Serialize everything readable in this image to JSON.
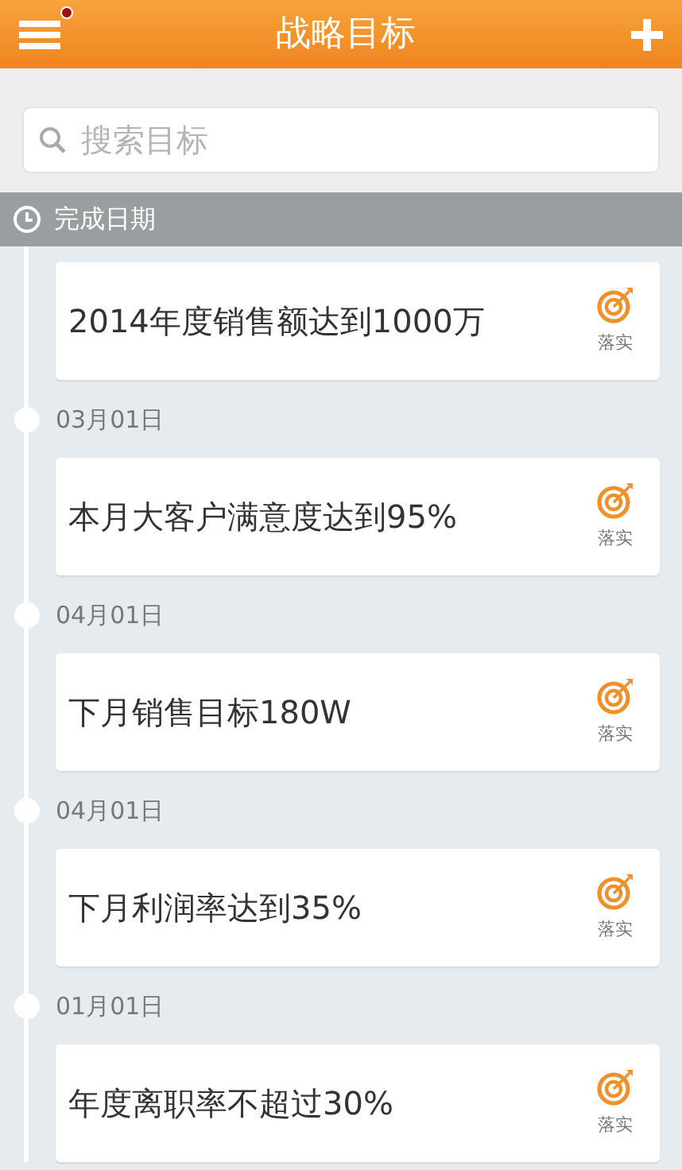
{
  "header": {
    "title": "战略目标",
    "menu_notification": true
  },
  "search": {
    "placeholder": "搜索目标"
  },
  "section": {
    "label": "完成日期"
  },
  "goals": [
    {
      "title": "2014年度销售额达到1000万",
      "action": "落实"
    },
    {
      "date": "03月01日",
      "title": "本月大客户满意度达到95%",
      "action": "落实"
    },
    {
      "date": "04月01日",
      "title": "下月销售目标180W",
      "action": "落实"
    },
    {
      "date": "04月01日",
      "title": "下月利润率达到35%",
      "action": "落实"
    },
    {
      "date": "01月01日",
      "title": "年度离职率不超过30%",
      "action": "落实"
    }
  ]
}
